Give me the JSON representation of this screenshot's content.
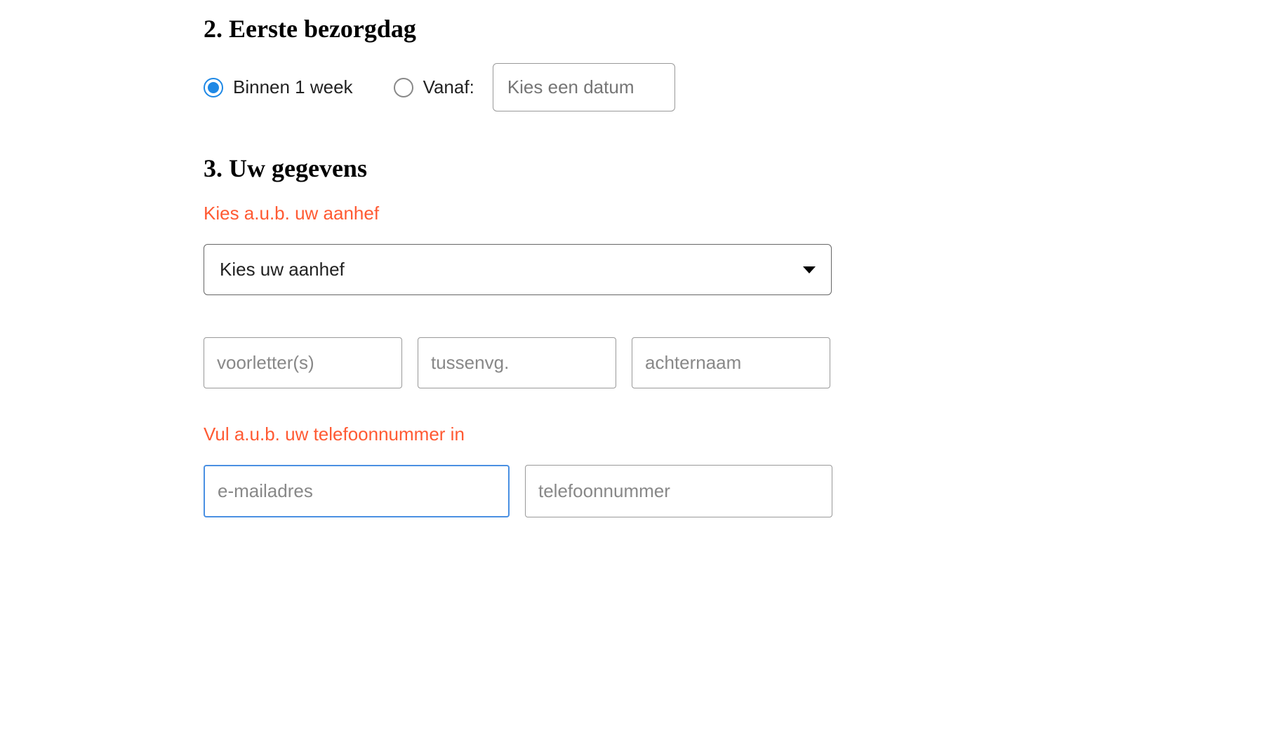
{
  "section2": {
    "heading": "2. Eerste bezorgdag",
    "option1_label": "Binnen 1 week",
    "option2_label": "Vanaf:",
    "date_placeholder": "Kies een datum"
  },
  "section3": {
    "heading": "3. Uw gegevens",
    "error_salutation": "Kies a.u.b. uw aanhef",
    "select_placeholder": "Kies uw aanhef",
    "initials_placeholder": "voorletter(s)",
    "middle_placeholder": "tussenvg.",
    "lastname_placeholder": "achternaam",
    "error_phone": "Vul a.u.b. uw telefoonnummer in",
    "email_placeholder": "e-mailadres",
    "phone_placeholder": "telefoonnummer"
  }
}
